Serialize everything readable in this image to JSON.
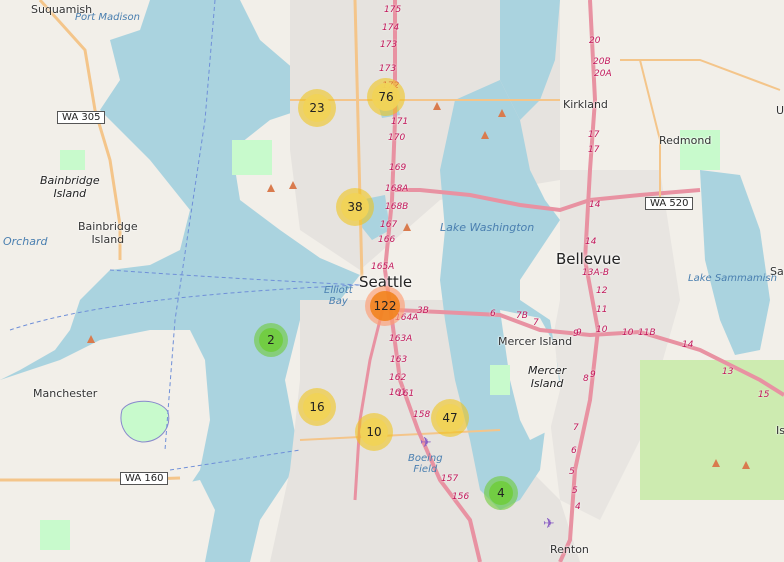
{
  "colors": {
    "water": "#aad3df",
    "land": "#f2efe9",
    "park": "#c8facc",
    "urban": "#e0dfdf",
    "motorway": "#e892a2",
    "primary": "#fcd6a4",
    "cluster_small": "#6ecc39",
    "cluster_medium": "#f1d357",
    "cluster_large": "#f18017"
  },
  "places": {
    "seattle": "Seattle",
    "bellevue": "Bellevue",
    "kirkland": "Kirkland",
    "redmond": "Redmond",
    "mercer_island_city": "Mercer Island",
    "mercer_island": "Mercer\nIsland",
    "manchester": "Manchester",
    "renton": "Renton",
    "suquamish": "Suquamish",
    "bainbridge_island_italic": "Bainbridge\nIsland",
    "bainbridge_island_town": "Bainbridge\nIsland",
    "boeing_field": "Boeing\nField",
    "port_madison": "Port Madison",
    "orchard": "Orchard",
    "lake_washington": "Lake Washington",
    "elliott_bay": "Elliott\nBay",
    "lake_sammamish": "Lake Sammamish",
    "edge_sa": "Sa",
    "edge_u": "U",
    "edge_is": "Is"
  },
  "shields": {
    "wa305": "WA 305",
    "wa520": "WA 520",
    "wa160": "WA 160"
  },
  "exits": {
    "i5": [
      "175",
      "174",
      "173",
      "173",
      "172",
      "171",
      "170",
      "169",
      "168A",
      "168B",
      "167",
      "166",
      "165A",
      "164A",
      "163A",
      "163",
      "162",
      "161",
      "161",
      "158",
      "157",
      "156"
    ],
    "i405": [
      "20",
      "20B",
      "20A",
      "17",
      "17",
      "14",
      "14",
      "13A-B",
      "12",
      "11",
      "10",
      "9",
      "9",
      "8",
      "7",
      "6",
      "5",
      "5",
      "4"
    ],
    "i90": [
      "3B",
      "6",
      "7B",
      "7",
      "9",
      "10",
      "11B",
      "14",
      "13",
      "15"
    ]
  },
  "clusters": [
    {
      "count": "23",
      "size": "medium"
    },
    {
      "count": "76",
      "size": "medium"
    },
    {
      "count": "38",
      "size": "medium"
    },
    {
      "count": "122",
      "size": "large"
    },
    {
      "count": "2",
      "size": "small"
    },
    {
      "count": "16",
      "size": "medium"
    },
    {
      "count": "10",
      "size": "medium"
    },
    {
      "count": "47",
      "size": "medium"
    },
    {
      "count": "4",
      "size": "small"
    }
  ]
}
